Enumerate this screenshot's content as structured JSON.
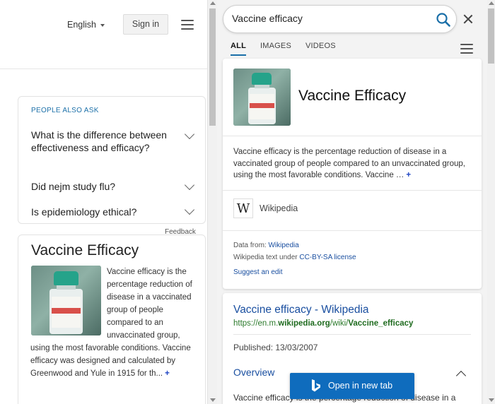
{
  "left": {
    "language": "English",
    "sign_in": "Sign in",
    "paa": {
      "title": "PEOPLE ALSO ASK",
      "questions": [
        "What is the difference between effectiveness and efficacy?",
        "Did nejm study flu?",
        "Is epidemiology ethical?"
      ]
    },
    "feedback": "Feedback",
    "entity": {
      "title": "Vaccine Efficacy",
      "text": "Vaccine efficacy is the percentage reduction of disease in a vaccinated group of people compared to an unvaccinated group, using the most favorable conditions. Vaccine efficacy was designed and calculated by Greenwood and Yule in 1915 for th...",
      "more": "+"
    }
  },
  "right": {
    "search": {
      "value": "Vaccine efficacy",
      "placeholder": ""
    },
    "tabs": [
      "ALL",
      "IMAGES",
      "VIDEOS"
    ],
    "active_tab": "ALL",
    "knowledge": {
      "title": "Vaccine Efficacy",
      "description": "Vaccine efficacy is the percentage reduction of disease in a vaccinated group of people compared to an unvaccinated group, using the most favorable conditions. Vaccine …",
      "more": "+",
      "source_logo": "W",
      "source_name": "Wikipedia",
      "data_from_label": "Data from: ",
      "data_from_link": "Wikipedia",
      "license_label": "Wikipedia text under ",
      "license_link": "CC-BY-SA license",
      "suggest_edit": "Suggest an edit"
    },
    "result": {
      "title": "Vaccine efficacy - Wikipedia",
      "url_prefix": "https://en.m.",
      "url_bold1": "wikipedia.org",
      "url_mid": "/wiki/",
      "url_bold2": "Vaccine_efficacy",
      "published": "Published: 13/03/2007",
      "overview": "Overview",
      "snippet": "Vaccine efficacy is the percentage reduction of disease in a"
    },
    "open_button": "Open in new tab"
  },
  "colors": {
    "accent": "#1a6fa8",
    "link": "#1a4fa0",
    "url_green": "#2b7a2b",
    "button_blue": "#0f6cbd",
    "vial_cap": "#25a38a"
  },
  "icons": [
    "caret-down-icon",
    "hamburger-icon",
    "chevron-down-icon",
    "search-icon",
    "close-icon",
    "wikipedia-icon",
    "chevron-up-icon",
    "bing-icon"
  ]
}
